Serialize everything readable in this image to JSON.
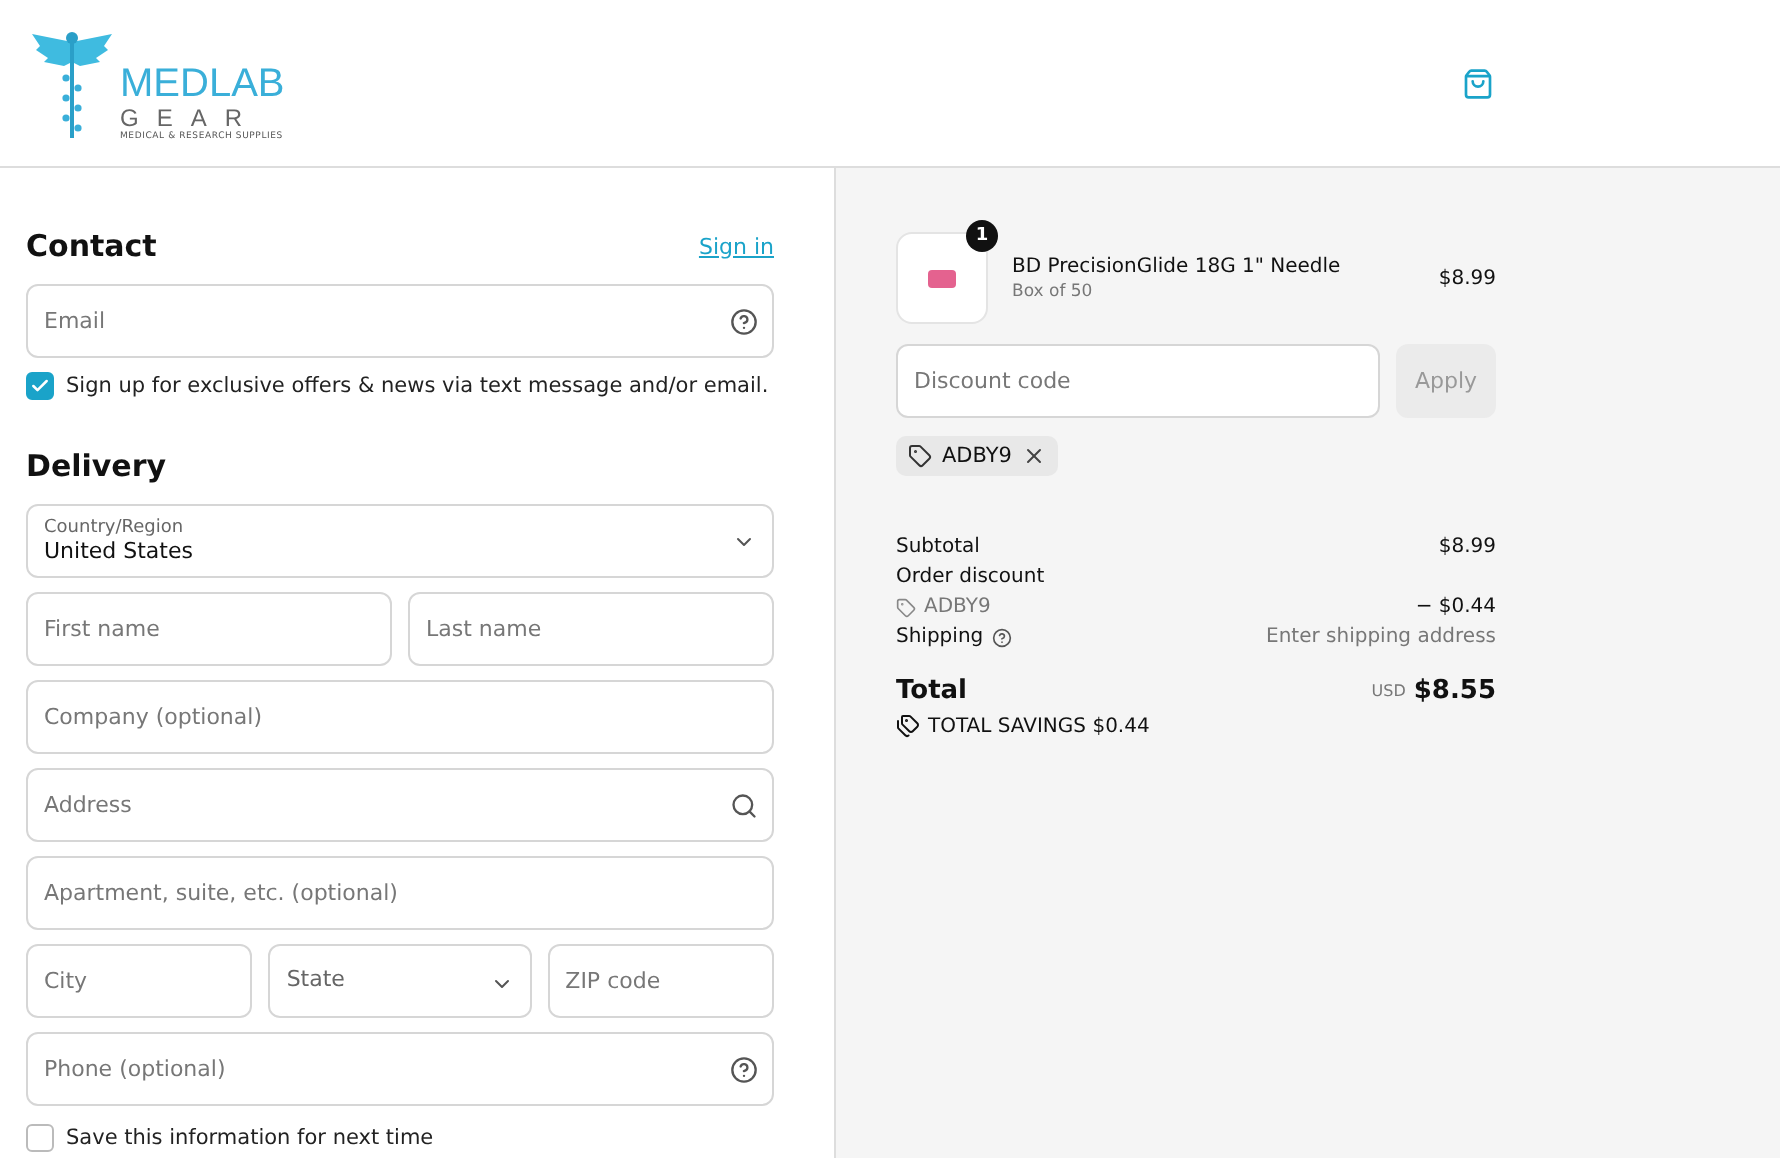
{
  "logo": {
    "name_top": "MEDLAB",
    "name_bottom": "GEAR",
    "tagline": "MEDICAL & RESEARCH SUPPLIES"
  },
  "contact": {
    "heading": "Contact",
    "sign_in": "Sign in",
    "email": {
      "placeholder": "Email"
    },
    "marketing_opt_in": {
      "label": "Sign up for exclusive offers & news via text message and/or email.",
      "checked": true
    }
  },
  "delivery": {
    "heading": "Delivery",
    "fields": [
      {
        "kind": "select",
        "label": "Country/Region",
        "value": "United States"
      },
      {
        "kind": "pair",
        "items": [
          {
            "placeholder": "First name"
          },
          {
            "placeholder": "Last name"
          }
        ]
      },
      {
        "kind": "text",
        "placeholder": "Company (optional)"
      },
      {
        "kind": "search",
        "placeholder": "Address"
      },
      {
        "kind": "text",
        "placeholder": "Apartment, suite, etc. (optional)"
      },
      {
        "kind": "triple",
        "items": [
          {
            "kind": "text",
            "placeholder": "City"
          },
          {
            "kind": "select",
            "placeholder": "State"
          },
          {
            "kind": "text",
            "placeholder": "ZIP code"
          }
        ]
      },
      {
        "kind": "help",
        "placeholder": "Phone (optional)"
      }
    ],
    "save_info": {
      "label": "Save this information for next time",
      "checked": false
    }
  },
  "summary": {
    "item": {
      "quantity": "1",
      "name": "BD PrecisionGlide 18G 1\" Needle",
      "variant": "Box of 50",
      "price": "$8.99"
    },
    "discount": {
      "placeholder": "Discount code",
      "button": "Apply",
      "applied_code": "ADBY9"
    },
    "lines": [
      {
        "label": "Subtotal",
        "value": "$8.99"
      },
      {
        "label": "Order discount",
        "code": "ADBY9",
        "value": "− $0.44"
      },
      {
        "label": "Shipping",
        "value": "Enter shipping address",
        "help": true
      }
    ],
    "total": {
      "label": "Total",
      "currency": "USD",
      "value": "$8.55"
    },
    "savings": {
      "label": "TOTAL SAVINGS",
      "value": "$0.44"
    }
  }
}
